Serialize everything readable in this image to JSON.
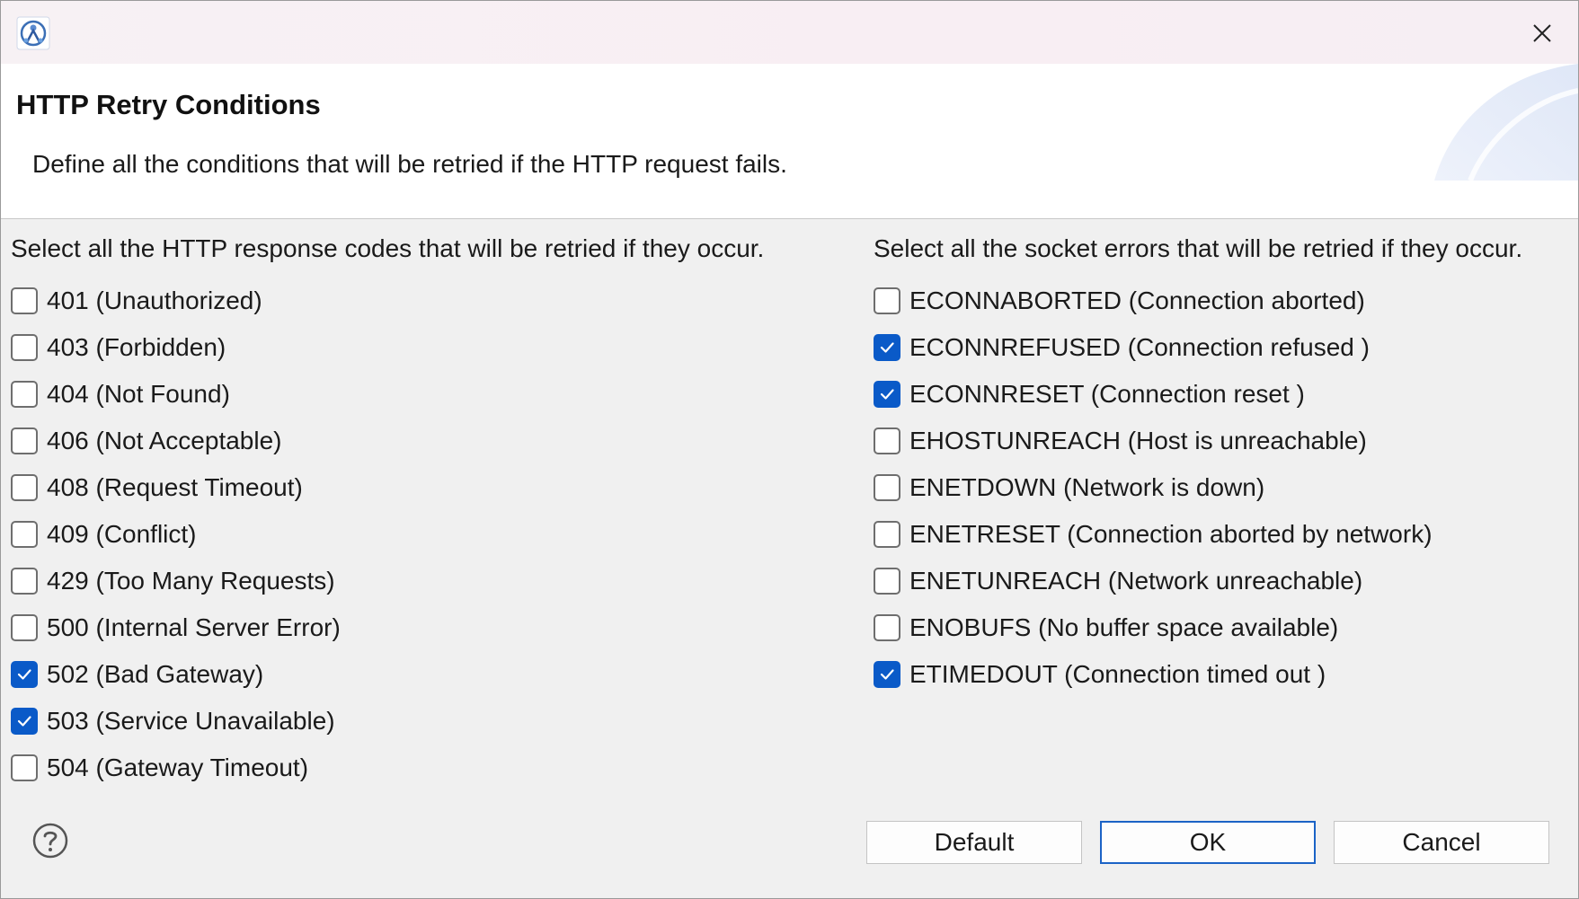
{
  "window": {
    "close_icon": "close-icon",
    "app_icon": "app-icon"
  },
  "header": {
    "title": "HTTP Retry Conditions",
    "description": "Define all the conditions that will be retried if the HTTP request fails."
  },
  "http_codes": {
    "caption": "Select all the HTTP response codes that will be retried if they occur.",
    "items": [
      {
        "label": "401 (Unauthorized)",
        "checked": false
      },
      {
        "label": "403 (Forbidden)",
        "checked": false
      },
      {
        "label": "404 (Not Found)",
        "checked": false
      },
      {
        "label": "406 (Not Acceptable)",
        "checked": false
      },
      {
        "label": "408 (Request Timeout)",
        "checked": false
      },
      {
        "label": "409 (Conflict)",
        "checked": false
      },
      {
        "label": "429 (Too Many Requests)",
        "checked": false
      },
      {
        "label": "500 (Internal Server Error)",
        "checked": false
      },
      {
        "label": "502 (Bad Gateway)",
        "checked": true
      },
      {
        "label": "503 (Service Unavailable)",
        "checked": true
      },
      {
        "label": "504 (Gateway Timeout)",
        "checked": false
      }
    ]
  },
  "socket_errors": {
    "caption": "Select all the socket errors that will be retried if they occur.",
    "items": [
      {
        "label": "ECONNABORTED (Connection aborted)",
        "checked": false
      },
      {
        "label": "ECONNREFUSED (Connection refused )",
        "checked": true
      },
      {
        "label": "ECONNRESET (Connection reset )",
        "checked": true
      },
      {
        "label": "EHOSTUNREACH (Host is unreachable)",
        "checked": false
      },
      {
        "label": "ENETDOWN (Network is down)",
        "checked": false
      },
      {
        "label": "ENETRESET (Connection aborted by network)",
        "checked": false
      },
      {
        "label": "ENETUNREACH (Network unreachable)",
        "checked": false
      },
      {
        "label": "ENOBUFS (No buffer space available)",
        "checked": false
      },
      {
        "label": "ETIMEDOUT (Connection timed out )",
        "checked": true
      }
    ]
  },
  "footer": {
    "help_icon": "help-icon",
    "default_label": "Default",
    "ok_label": "OK",
    "cancel_label": "Cancel"
  },
  "colors": {
    "accent": "#0a5ac8",
    "primary_button_border": "#1b63c6",
    "title_bar": "#f8eef3"
  }
}
